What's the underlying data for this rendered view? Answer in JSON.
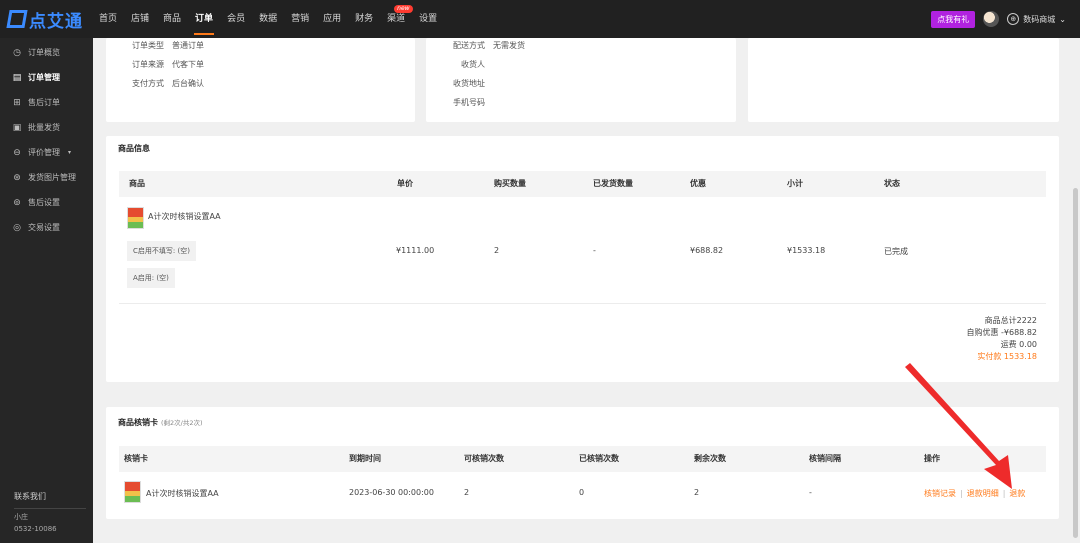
{
  "brand": {
    "name": "点艾通"
  },
  "nav": {
    "items": [
      "首页",
      "店铺",
      "商品",
      "订单",
      "会员",
      "数据",
      "营销",
      "应用",
      "财务",
      "渠道",
      "设置"
    ],
    "new_badge": "new"
  },
  "top_right": {
    "gift": "点我有礼",
    "store": "数码商城"
  },
  "sidebar": {
    "items": [
      {
        "label": "订单概览"
      },
      {
        "label": "订单管理"
      },
      {
        "label": "售后订单"
      },
      {
        "label": "批量发货"
      },
      {
        "label": "评价管理"
      },
      {
        "label": "发货图片管理"
      },
      {
        "label": "售后设置"
      },
      {
        "label": "交易设置"
      }
    ],
    "contact": {
      "title": "联系我们",
      "name": "小庄",
      "phone": "0532-10086"
    }
  },
  "order_info": {
    "left": [
      {
        "k": "订单类型",
        "v": "普通订单"
      },
      {
        "k": "订单来源",
        "v": "代客下单"
      },
      {
        "k": "支付方式",
        "v": "后台确认"
      }
    ],
    "right": [
      {
        "k": "配送方式",
        "v": "无需发货"
      },
      {
        "k": "收货人",
        "v": ""
      },
      {
        "k": "收货地址",
        "v": ""
      },
      {
        "k": "手机号码",
        "v": ""
      }
    ]
  },
  "goods": {
    "title": "商品信息",
    "columns": [
      "商品",
      "单价",
      "购买数量",
      "已发货数量",
      "优惠",
      "小计",
      "状态"
    ],
    "row": {
      "name": "A计次时核销设置AA",
      "tags": [
        "C启用不填写: (空)",
        "A启用: (空)"
      ],
      "price": "¥1111.00",
      "qty": "2",
      "shipped": "-",
      "discount": "¥688.82",
      "subtotal": "¥1533.18",
      "status": "已完成"
    },
    "summary": {
      "total": "商品总计2222",
      "self_discount": "自购优惠 -¥688.82",
      "freight": "运费 0.00",
      "paid": "实付款 1533.18"
    }
  },
  "cards": {
    "title": "商品核销卡",
    "subtitle": "(剩2次/共2次)",
    "columns": [
      "核销卡",
      "到期时间",
      "可核销次数",
      "已核销次数",
      "剩余次数",
      "核销间隔",
      "操作"
    ],
    "row": {
      "name": "A计次时核销设置AA",
      "expire": "2023-06-30 00:00:00",
      "available": "2",
      "used": "0",
      "remaining": "2",
      "interval": "-",
      "ops": [
        "核销记录",
        "退款明细",
        "退款"
      ]
    }
  },
  "colors": {
    "accent": "#ff7a1a",
    "topbar": "#212121",
    "sidebar": "#262626",
    "gift": "#b122e0",
    "arrow": "#ee2b2b"
  }
}
